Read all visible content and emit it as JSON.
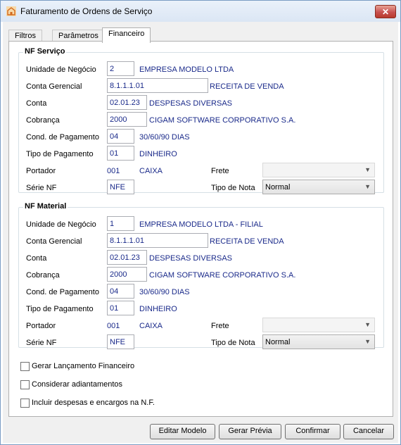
{
  "window": {
    "title": "Faturamento de Ordens de Serviço",
    "close_label": "✕"
  },
  "tabs": [
    "Filtros",
    "Parâmetros",
    "Financeiro"
  ],
  "nf_servico": {
    "title": "NF Serviço",
    "unidade": {
      "label": "Unidade de Negócio",
      "code": "2",
      "desc": "EMPRESA MODELO LTDA"
    },
    "conta_gerencial": {
      "label": "Conta Gerencial",
      "code": "8.1.1.1.01",
      "desc": "RECEITA DE VENDA"
    },
    "conta": {
      "label": "Conta",
      "code": "02.01.23",
      "desc": "DESPESAS DIVERSAS"
    },
    "cobranca": {
      "label": "Cobrança",
      "code": "2000",
      "desc": "CIGAM SOFTWARE CORPORATIVO S.A."
    },
    "cond_pagamento": {
      "label": "Cond. de Pagamento",
      "code": "04",
      "desc": "30/60/90 DIAS"
    },
    "tipo_pagamento": {
      "label": "Tipo de Pagamento",
      "code": "01",
      "desc": "DINHEIRO"
    },
    "portador": {
      "label": "Portador",
      "code": "001",
      "desc": "CAIXA"
    },
    "frete": {
      "label": "Frete",
      "value": ""
    },
    "serie": {
      "label": "Série NF",
      "value": "NFE"
    },
    "tipo_nota": {
      "label": "Tipo de Nota",
      "value": "Normal"
    }
  },
  "nf_material": {
    "title": "NF Material",
    "unidade": {
      "label": "Unidade de Negócio",
      "code": "1",
      "desc": "EMPRESA MODELO LTDA - FILIAL"
    },
    "conta_gerencial": {
      "label": "Conta Gerencial",
      "code": "8.1.1.1.01",
      "desc": "RECEITA DE VENDA"
    },
    "conta": {
      "label": "Conta",
      "code": "02.01.23",
      "desc": "DESPESAS DIVERSAS"
    },
    "cobranca": {
      "label": "Cobrança",
      "code": "2000",
      "desc": "CIGAM SOFTWARE CORPORATIVO S.A."
    },
    "cond_pagamento": {
      "label": "Cond. de Pagamento",
      "code": "04",
      "desc": "30/60/90 DIAS"
    },
    "tipo_pagamento": {
      "label": "Tipo de Pagamento",
      "code": "01",
      "desc": "DINHEIRO"
    },
    "portador": {
      "label": "Portador",
      "code": "001",
      "desc": "CAIXA"
    },
    "frete": {
      "label": "Frete",
      "value": ""
    },
    "serie": {
      "label": "Série NF",
      "value": "NFE"
    },
    "tipo_nota": {
      "label": "Tipo de Nota",
      "value": "Normal"
    }
  },
  "checkboxes": {
    "gerar_lancamento": {
      "label": "Gerar Lançamento Financeiro",
      "checked": false
    },
    "considerar_adiantamentos": {
      "label": "Considerar adiantamentos",
      "checked": false
    },
    "incluir_despesas": {
      "label": "Incluir despesas e encargos na N.F.",
      "checked": false
    }
  },
  "buttons": {
    "editar_modelo": "Editar Modelo",
    "gerar_previa": "Gerar Prévia",
    "confirmar": "Confirmar",
    "cancelar": "Cancelar"
  }
}
